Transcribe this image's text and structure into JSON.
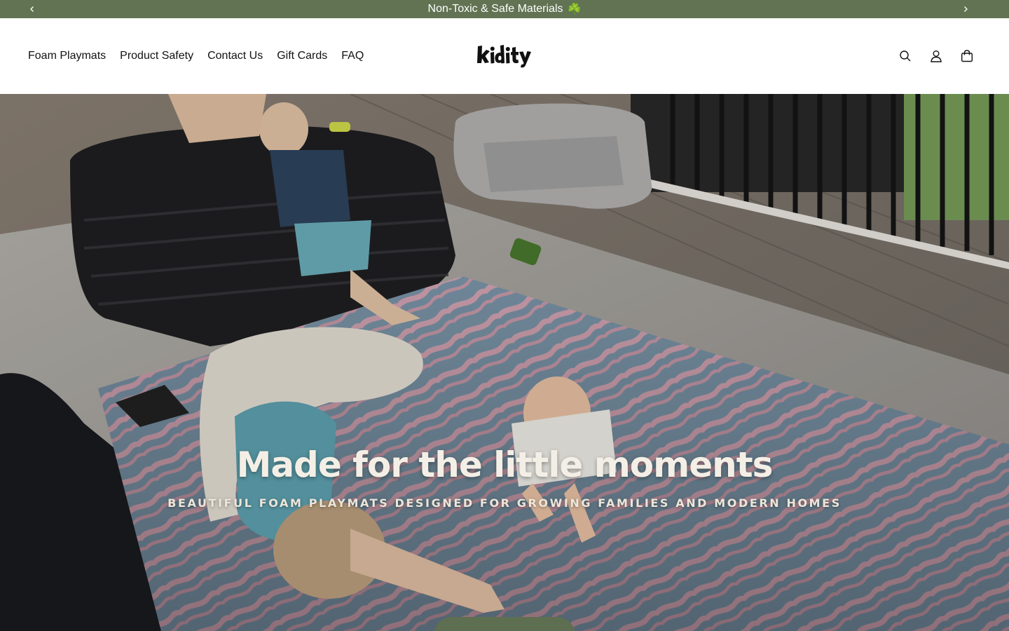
{
  "announcement": {
    "message": "Non-Toxic & Safe Materials",
    "emoji": "☘️",
    "prev_icon": "chevron-left-icon",
    "next_icon": "chevron-right-icon",
    "background": "#627353"
  },
  "header": {
    "nav": [
      {
        "label": "Foam Playmats"
      },
      {
        "label": "Product Safety"
      },
      {
        "label": "Contact Us"
      },
      {
        "label": "Gift Cards"
      },
      {
        "label": "FAQ"
      }
    ],
    "logo_text": "kidity",
    "icons": [
      "search-icon",
      "account-icon",
      "cart-icon"
    ]
  },
  "hero": {
    "title": "Made for the little moments",
    "subtitle": "Beautiful foam playmats designed for growing families and modern homes",
    "button_color": "#5e6e50"
  }
}
